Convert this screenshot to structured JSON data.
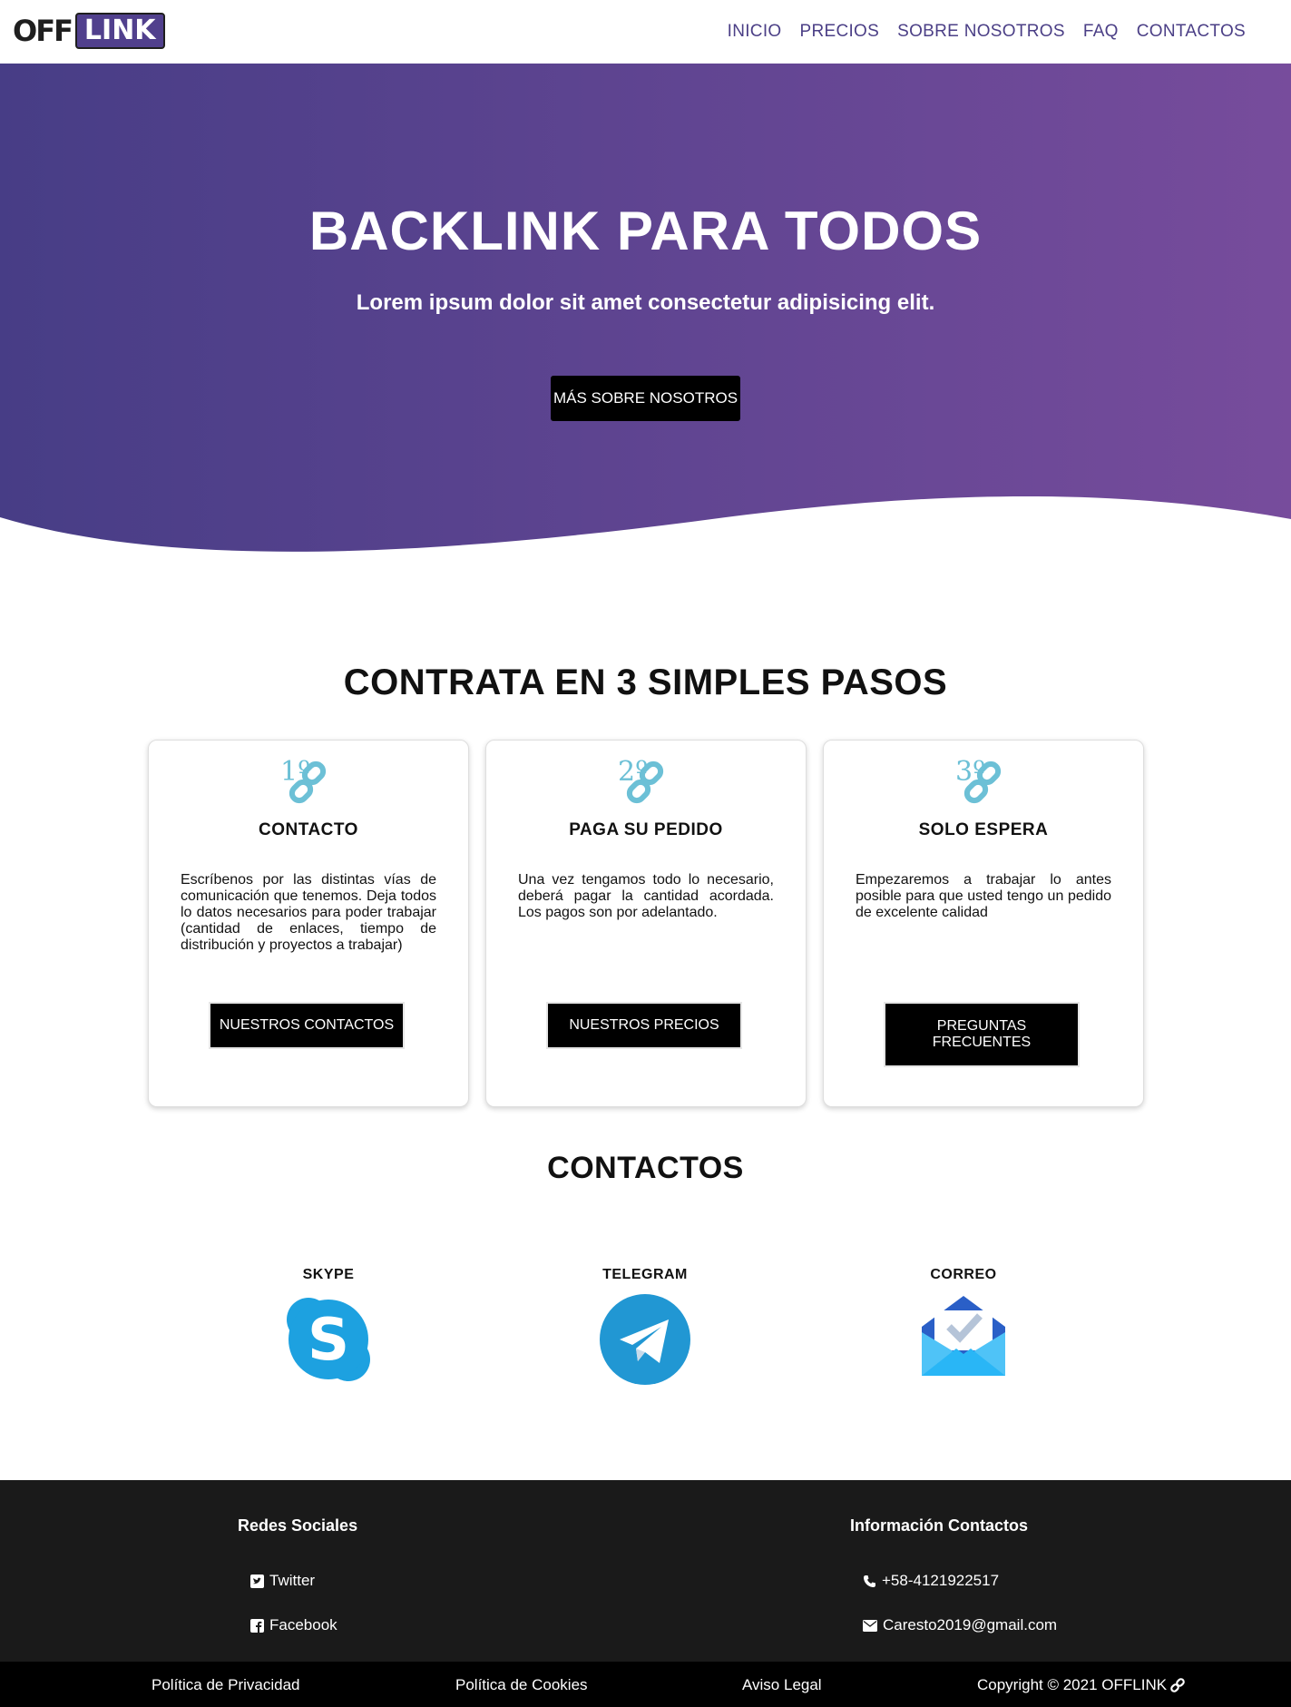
{
  "brand": {
    "logo_left": "OFF",
    "logo_right": "LINK"
  },
  "nav": {
    "items": [
      "INICIO",
      "PRECIOS",
      "SOBRE NOSOTROS",
      "FAQ",
      "CONTACTOS"
    ]
  },
  "hero": {
    "title": "BACKLINK PARA TODOS",
    "subtitle": "Lorem ipsum dolor sit amet consectetur adipisicing elit.",
    "button": "MÁS SOBRE NOSOTROS",
    "gradient": [
      "#473d86",
      "#774c9c"
    ]
  },
  "steps": {
    "title": "CONTRATA EN 3 SIMPLES PASOS",
    "cards": [
      {
        "number": "1º",
        "title": "CONTACTO",
        "text": "Escríbenos por las distintas vías de comunicación que tenemos. Deja todos lo datos necesarios para poder trabajar (cantidad de enlaces, tiempo de distribución y proyectos a trabajar)",
        "button": "NUESTROS CONTACTOS"
      },
      {
        "number": "2º",
        "title": "PAGA SU PEDIDO",
        "text": "Una vez tengamos todo lo necesario, deberá pagar la cantidad acordada. Los pagos son por adelantado.",
        "button": "NUESTROS PRECIOS"
      },
      {
        "number": "3º",
        "title": "SOLO ESPERA",
        "text": "Empezaremos a trabajar lo antes posible para que usted tengo un pedido de excelente calidad",
        "button": "PREGUNTAS FRECUENTES"
      }
    ]
  },
  "contacts": {
    "title": "CONTACTOS",
    "items": [
      {
        "label": "SKYPE",
        "icon": "skype-icon"
      },
      {
        "label": "TELEGRAM",
        "icon": "telegram-icon"
      },
      {
        "label": "CORREO",
        "icon": "mail-icon"
      }
    ]
  },
  "footer": {
    "social_heading": "Redes Sociales",
    "social": [
      {
        "label": "Twitter",
        "icon": "twitter-icon"
      },
      {
        "label": "Facebook",
        "icon": "facebook-icon"
      }
    ],
    "info_heading": "Información Contactos",
    "info": [
      {
        "label": "+58-4121922517",
        "icon": "phone-icon"
      },
      {
        "label": "Caresto2019@gmail.com",
        "icon": "envelope-icon"
      }
    ]
  },
  "bottom": {
    "privacy": "Política de Privacidad",
    "cookies": "Política de Cookies",
    "legal": "Aviso Legal",
    "copyright": "Copyright © 2021 OFFLINK"
  }
}
